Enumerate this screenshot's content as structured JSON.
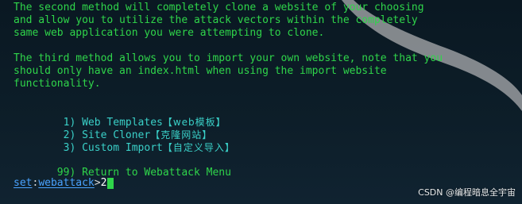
{
  "colors": {
    "background": "#0b1a24",
    "text_green": "#2fd54a",
    "menu_cyan": "#3ad0c8",
    "prompt_blue": "#4aa3ff",
    "swoosh": "#8a8e92"
  },
  "paragraphs": {
    "second_method": [
      "The second method will completely clone a website of your choosing",
      "and allow you to utilize the attack vectors within the completely",
      "same web application you were attempting to clone."
    ],
    "third_method": [
      "The third method allows you to import your own website, note that you",
      "should only have an index.html when using the import website",
      "functionality."
    ]
  },
  "menu": [
    {
      "num": "  1)",
      "label": "Web Templates",
      "cjk": "【web模板】"
    },
    {
      "num": "  2)",
      "label": "Site Cloner",
      "cjk": "【克隆网站】"
    },
    {
      "num": "  3)",
      "label": "Custom Import",
      "cjk": "【自定义导入】"
    }
  ],
  "return_item": {
    "num": " 99)",
    "label": "Return to Webattack Menu"
  },
  "prompt": {
    "set": "set",
    "colon": ":",
    "module": "webattack",
    "gt": ">",
    "input": "2"
  },
  "watermark": "CSDN @编程暗息全宇宙",
  "icons": {
    "cursor": "block-cursor-icon"
  }
}
